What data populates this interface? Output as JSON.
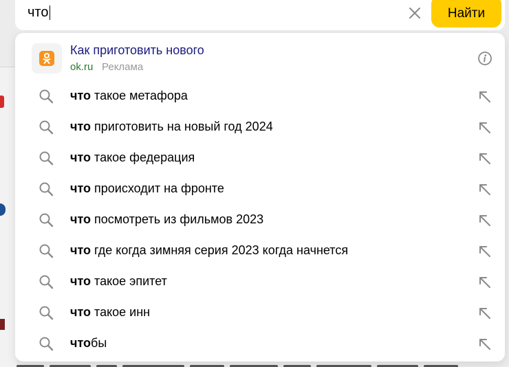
{
  "search": {
    "query": "что",
    "button_label": "Найти"
  },
  "ad": {
    "title": "Как приготовить нового",
    "domain": "ok.ru",
    "label": "Реклама",
    "logo_color": "#f7931e"
  },
  "suggestions": [
    {
      "bold": "что",
      "rest": " такое метафора"
    },
    {
      "bold": "что",
      "rest": " приготовить на новый год 2024"
    },
    {
      "bold": "что",
      "rest": " такое федерация"
    },
    {
      "bold": "что",
      "rest": " происходит на фронте"
    },
    {
      "bold": "что",
      "rest": " посмотреть из фильмов 2023"
    },
    {
      "bold": "что",
      "rest": " где когда зимняя серия 2023 когда начнется"
    },
    {
      "bold": "что",
      "rest": " такое эпитет"
    },
    {
      "bold": "что",
      "rest": " такое инн"
    },
    {
      "bold": "что",
      "rest": "бы"
    }
  ],
  "colors": {
    "accent": "#ffcc00",
    "ad_title": "#1a1a80",
    "ad_domain": "#2a7a2a"
  }
}
